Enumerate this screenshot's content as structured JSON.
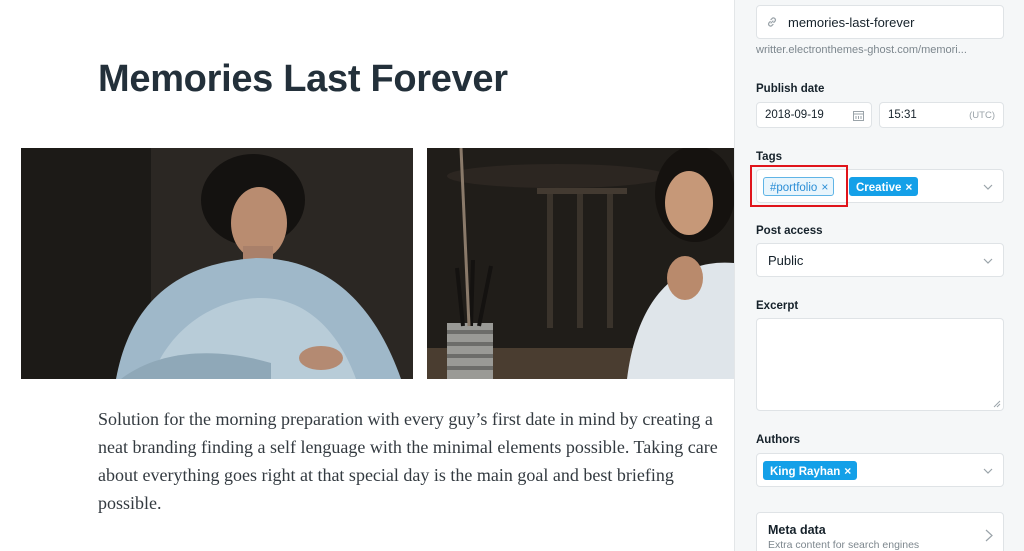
{
  "editor": {
    "title": "Memories Last Forever",
    "body": "Solution for the morning preparation with every guy’s first date in mind by creating a neat branding finding a self lenguage with the minimal elements possible. Taking care about everything goes right at that special day is the main goal and best briefing possible."
  },
  "sidebar": {
    "url_slug": "memories-last-forever",
    "url_hint": "writter.electronthemes-ghost.com/memori...",
    "publish_date_label": "Publish date",
    "date": "2018-09-19",
    "time": "15:31",
    "timezone": "(UTC)",
    "tags_label": "Tags",
    "tags": [
      {
        "label": "#portfolio",
        "remove": "×"
      },
      {
        "label": "Creative",
        "remove": "×"
      }
    ],
    "post_access_label": "Post access",
    "post_access_value": "Public",
    "excerpt_label": "Excerpt",
    "excerpt_value": "",
    "authors_label": "Authors",
    "authors": [
      {
        "label": "King Rayhan",
        "remove": "×"
      }
    ],
    "meta_title": "Meta data",
    "meta_subtitle": "Extra content for search engines"
  },
  "colors": {
    "accent": "#14a0e8",
    "highlight": "#e0141b",
    "sidebar_bg": "#f5f7f8"
  },
  "icons": [
    "link-icon",
    "calendar-icon",
    "chevron-down-icon",
    "close-icon",
    "chevron-right-icon"
  ]
}
